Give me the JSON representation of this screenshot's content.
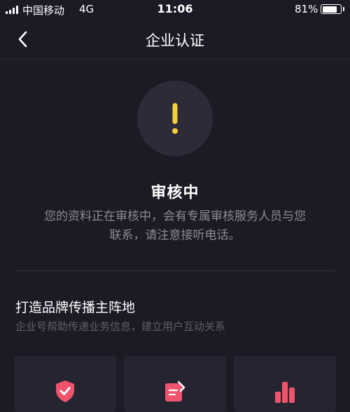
{
  "status_bar": {
    "carrier": "中国移动",
    "network": "4G",
    "time": "11:06",
    "battery_percent": "81%",
    "battery_level": 0.81
  },
  "nav": {
    "title": "企业认证",
    "back_icon": "chevron-left-icon"
  },
  "review": {
    "icon": "exclamation-icon",
    "icon_color": "#f6d03a",
    "title": "审核中",
    "description_line1": "您的资料正在审核中，会有专属审核服务人员与您",
    "description_line2": "联系，请注意接听电话。"
  },
  "section": {
    "title": "打造品牌传播主阵地",
    "description": "企业号帮助传递业务信息，建立用户互动关系"
  },
  "feature_cards": [
    {
      "icon": "verified-shield-icon"
    },
    {
      "icon": "edit-document-icon"
    },
    {
      "icon": "bar-chart-icon"
    }
  ],
  "colors": {
    "background": "#1b1a25",
    "card": "#252431",
    "accent_pink": "#f0546d",
    "warning_yellow": "#f6d03a"
  }
}
